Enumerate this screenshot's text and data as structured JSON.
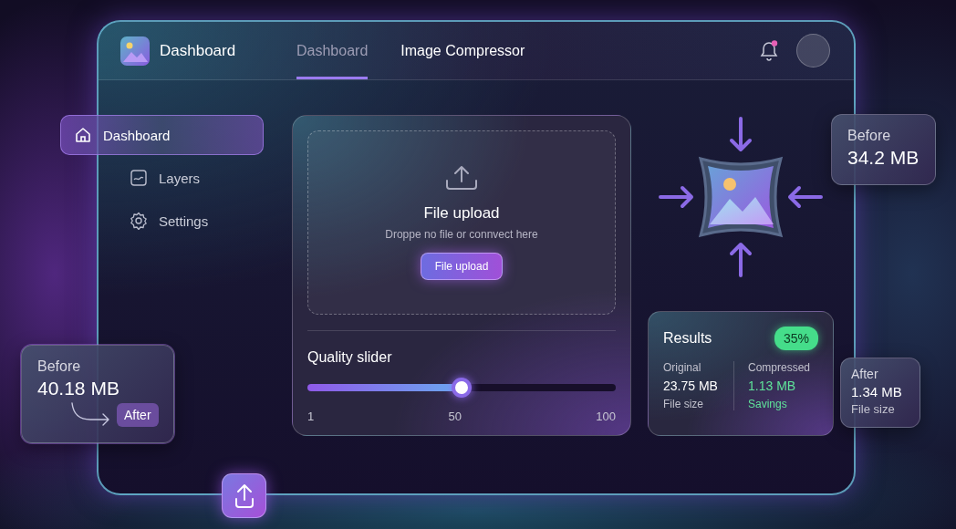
{
  "header": {
    "brand": "Dashboard",
    "notifications": {
      "unread": true
    }
  },
  "tabs": [
    {
      "label": "Dashboard",
      "selected": true
    },
    {
      "label": "Image Compressor",
      "selected": false
    }
  ],
  "sidebar": {
    "items": [
      {
        "label": "Dashboard",
        "selected": true
      },
      {
        "label": "Layers",
        "selected": false
      },
      {
        "label": "Settings",
        "selected": false
      }
    ]
  },
  "upload": {
    "title": "File upload",
    "hint": "Droppe no file or connvect here",
    "button": "File upload"
  },
  "quality": {
    "label": "Quality slider",
    "level": 0.5,
    "ticks": [
      "1",
      "50",
      "100"
    ]
  },
  "results": {
    "title": "Results",
    "badge": "35%",
    "columns": [
      {
        "kind": "neutral",
        "label": "Original",
        "value": "23.75 MB",
        "caption": "File size"
      },
      {
        "kind": "highlight",
        "label": "Compressed",
        "value": "1.13 MB",
        "caption": "Savings"
      }
    ]
  },
  "callouts": [
    {
      "kind": "before_tag",
      "label": "Before",
      "value": "40.18 MB",
      "tag": "After"
    },
    {
      "kind": "plain",
      "label": "Before",
      "value": "34.2 MB"
    },
    {
      "kind": "caption",
      "label": "After",
      "value": "1.34 MB",
      "caption": "File size"
    }
  ]
}
